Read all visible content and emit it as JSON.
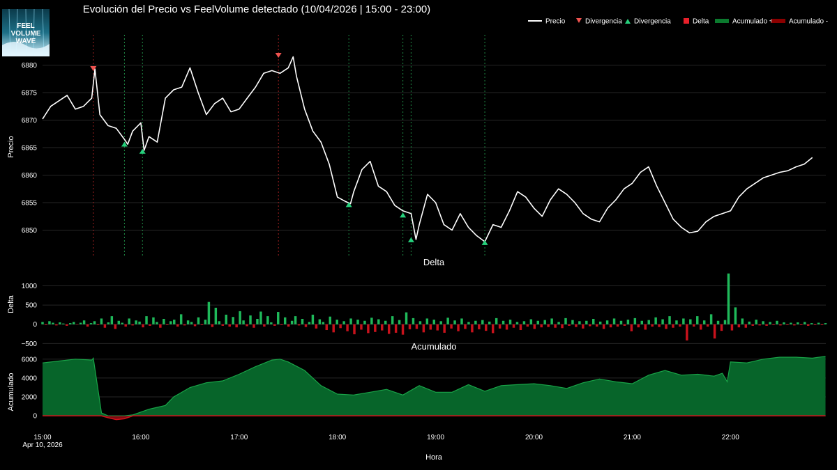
{
  "header": {
    "title": "Evolución del Precio vs FeelVolume detectado (10/04/2026 | 15:00 - 23:00)",
    "logo_text": "FEEL VOLUME WAVE"
  },
  "legend": {
    "placement": "top-right",
    "items": [
      {
        "label": "Precio",
        "kind": "line",
        "color": "#ffffff"
      },
      {
        "label": "Divergencia",
        "kind": "triangle-down",
        "color": "#ef5350"
      },
      {
        "label": "Divergencia",
        "kind": "triangle-up",
        "color": "#26d07c"
      },
      {
        "label": "Delta",
        "kind": "square",
        "color": "#e8202a"
      },
      {
        "label": "Acumulado +",
        "kind": "area",
        "color": "#0b7a2e"
      },
      {
        "label": "Acumulado -",
        "kind": "area",
        "color": "#8b0000"
      }
    ]
  },
  "colors": {
    "background": "#000000",
    "price_line": "#ffffff",
    "div_bear": "#ef5350",
    "div_bull": "#26d07c",
    "delta_pos": "#1fb95a",
    "delta_neg": "#c8121c",
    "acum_pos_fill": "#07652a",
    "acum_pos_line": "#19a448",
    "acum_neg": "#d0101a",
    "grid": "#262626",
    "vline_bear": "#a02020",
    "vline_bull": "#1f8a45"
  },
  "x_axis": {
    "label": "Hora",
    "ticks": [
      {
        "t": 15,
        "label": "15:00",
        "sub": "Apr 10, 2026"
      },
      {
        "t": 16,
        "label": "16:00"
      },
      {
        "t": 17,
        "label": "17:00"
      },
      {
        "t": 18,
        "label": "18:00"
      },
      {
        "t": 19,
        "label": "19:00"
      },
      {
        "t": 20,
        "label": "20:00"
      },
      {
        "t": 21,
        "label": "21:00"
      },
      {
        "t": 22,
        "label": "22:00"
      }
    ],
    "range": [
      15.0,
      22.97
    ]
  },
  "chart_data": [
    {
      "type": "line",
      "name": "precio",
      "ylabel": "Precio",
      "ylim": [
        6845,
        6885.5
      ],
      "yticks": [
        6850,
        6855,
        6860,
        6865,
        6870,
        6875,
        6880
      ],
      "grid": true,
      "x": [
        "15:00",
        "15:05",
        "15:10",
        "15:15",
        "15:20",
        "15:25",
        "15:30",
        "15:32",
        "15:35",
        "15:40",
        "15:45",
        "15:50",
        "15:52",
        "15:55",
        "16:00",
        "16:02",
        "16:05",
        "16:10",
        "16:15",
        "16:20",
        "16:25",
        "16:30",
        "16:35",
        "16:40",
        "16:45",
        "16:50",
        "16:55",
        "17:00",
        "17:05",
        "17:10",
        "17:15",
        "17:20",
        "17:25",
        "17:30",
        "17:33",
        "17:35",
        "17:40",
        "17:45",
        "17:50",
        "17:55",
        "18:00",
        "18:05",
        "18:08",
        "18:10",
        "18:15",
        "18:20",
        "18:25",
        "18:30",
        "18:35",
        "18:40",
        "18:45",
        "18:48",
        "18:50",
        "18:55",
        "19:00",
        "19:05",
        "19:10",
        "19:15",
        "19:20",
        "19:25",
        "19:30",
        "19:35",
        "19:40",
        "19:45",
        "19:50",
        "19:55",
        "20:00",
        "20:05",
        "20:10",
        "20:15",
        "20:20",
        "20:25",
        "20:30",
        "20:35",
        "20:40",
        "20:45",
        "20:50",
        "20:55",
        "21:00",
        "21:05",
        "21:10",
        "21:15",
        "21:20",
        "21:25",
        "21:30",
        "21:35",
        "21:40",
        "21:45",
        "21:50",
        "21:55",
        "22:00",
        "22:05",
        "22:10",
        "22:15",
        "22:20",
        "22:25",
        "22:30",
        "22:35",
        "22:40",
        "22:45",
        "22:50",
        "22:55",
        "22:58"
      ],
      "values": [
        6870.2,
        6872.5,
        6873.5,
        6874.5,
        6872,
        6872.5,
        6874,
        6879.3,
        6871,
        6869,
        6868.5,
        6866.5,
        6865.6,
        6868,
        6869.5,
        6864.5,
        6867,
        6866,
        6874,
        6875.5,
        6876,
        6879.5,
        6875,
        6871,
        6873,
        6874,
        6871.5,
        6872,
        6874,
        6876,
        6878.5,
        6879,
        6878.5,
        6879.5,
        6881.5,
        6878,
        6872,
        6868,
        6866,
        6862,
        6856,
        6855.2,
        6854.8,
        6857,
        6861,
        6862.5,
        6858,
        6857,
        6854.5,
        6853.5,
        6853,
        6848.3,
        6851,
        6856.5,
        6855,
        6851,
        6850,
        6853,
        6850.5,
        6849,
        6847.9,
        6851,
        6850.5,
        6853.5,
        6857,
        6856,
        6854,
        6852.5,
        6855.5,
        6857.5,
        6856.5,
        6855,
        6853,
        6852,
        6851.5,
        6854,
        6855.5,
        6857.5,
        6858.5,
        6860.5,
        6861.5,
        6858,
        6855,
        6852,
        6850.5,
        6849.5,
        6849.8,
        6851.5,
        6852.5,
        6853,
        6853.5,
        6856,
        6857.5,
        6858.5,
        6859.5,
        6860,
        6860.5,
        6860.8,
        6861.5,
        6862,
        6863.2
      ],
      "divergences": [
        {
          "x": "15:31",
          "y": 6879.3,
          "type": "bajista"
        },
        {
          "x": "15:50",
          "y": 6865.7,
          "type": "alcista"
        },
        {
          "x": "16:01",
          "y": 6864.4,
          "type": "alcista"
        },
        {
          "x": "17:24",
          "y": 6881.7,
          "type": "bajista"
        },
        {
          "x": "18:07",
          "y": 6854.7,
          "type": "alcista"
        },
        {
          "x": "18:40",
          "y": 6852.8,
          "type": "alcista"
        },
        {
          "x": "18:45",
          "y": 6848.3,
          "type": "alcista"
        },
        {
          "x": "19:30",
          "y": 6847.8,
          "type": "alcista"
        }
      ]
    },
    {
      "type": "bar",
      "name": "delta",
      "title": "Delta",
      "ylabel": "Delta",
      "ylim": [
        -620,
        1370
      ],
      "yticks": [
        -500,
        0,
        500,
        1000
      ],
      "grid": true,
      "x_start": "15:00",
      "x_end": "22:58",
      "values": [
        60,
        -20,
        80,
        40,
        -30,
        50,
        20,
        -40,
        30,
        60,
        -10,
        40,
        100,
        -60,
        30,
        80,
        -20,
        150,
        -90,
        50,
        210,
        -120,
        90,
        40,
        -60,
        150,
        -30,
        100,
        70,
        -80,
        210,
        -40,
        180,
        60,
        -90,
        140,
        -20,
        80,
        120,
        -60,
        260,
        -30,
        100,
        60,
        -50,
        180,
        -20,
        120,
        580,
        -70,
        430,
        80,
        -40,
        250,
        -60,
        190,
        -80,
        340,
        100,
        -50,
        230,
        -90,
        140,
        330,
        -60,
        210,
        50,
        -40,
        320,
        -20,
        180,
        -60,
        90,
        210,
        -30,
        140,
        -70,
        60,
        250,
        -110,
        130,
        60,
        -150,
        200,
        -210,
        120,
        -100,
        80,
        -180,
        150,
        -260,
        120,
        -140,
        90,
        -230,
        170,
        -200,
        130,
        -160,
        90,
        -250,
        210,
        -220,
        110,
        -270,
        310,
        -130,
        160,
        -120,
        80,
        -210,
        150,
        -140,
        120,
        -160,
        80,
        -220,
        170,
        -110,
        100,
        -180,
        150,
        -120,
        60,
        -210,
        90,
        -130,
        110,
        -170,
        70,
        -230,
        160,
        -110,
        90,
        -140,
        120,
        -90,
        60,
        -150,
        80,
        -60,
        130,
        -120,
        90,
        -80,
        110,
        -70,
        150,
        -90,
        60,
        -100,
        160,
        -40,
        110,
        -70,
        80,
        -110,
        90,
        -50,
        140,
        -60,
        70,
        -120,
        100,
        -80,
        150,
        -60,
        90,
        -40,
        120,
        -180,
        160,
        -80,
        90,
        -140,
        110,
        -60,
        180,
        -70,
        130,
        -120,
        210,
        -90,
        100,
        -60,
        150,
        -420,
        130,
        -60,
        210,
        -140,
        100,
        -60,
        260,
        -370,
        90,
        -170,
        110,
        1320,
        -160,
        440,
        -80,
        150,
        -90,
        70,
        -40,
        120,
        -30,
        80,
        -40,
        60,
        -20,
        90,
        -30,
        50,
        -20,
        40,
        -30,
        50,
        -20,
        60,
        -40,
        30,
        -20,
        40,
        -20,
        30
      ]
    },
    {
      "type": "area",
      "name": "acumulado",
      "title": "Acumulado",
      "ylabel": "Acumulado",
      "ylim": [
        -500,
        6350
      ],
      "yticks": [
        0,
        2000,
        4000,
        6000
      ],
      "grid": true,
      "x": [
        "15:00",
        "15:10",
        "15:20",
        "15:30",
        "15:31",
        "15:36",
        "15:40",
        "15:45",
        "15:50",
        "15:55",
        "16:00",
        "16:05",
        "16:10",
        "16:15",
        "16:20",
        "16:30",
        "16:40",
        "16:50",
        "17:00",
        "17:10",
        "17:20",
        "17:25",
        "17:30",
        "17:40",
        "17:50",
        "18:00",
        "18:10",
        "18:20",
        "18:30",
        "18:40",
        "18:50",
        "19:00",
        "19:10",
        "19:20",
        "19:30",
        "19:40",
        "19:50",
        "20:00",
        "20:10",
        "20:20",
        "20:30",
        "20:40",
        "20:50",
        "21:00",
        "21:10",
        "21:20",
        "21:30",
        "21:40",
        "21:50",
        "21:55",
        "21:58",
        "22:00",
        "22:10",
        "22:20",
        "22:30",
        "22:40",
        "22:50",
        "22:58"
      ],
      "values": [
        5600,
        5800,
        6000,
        5900,
        6100,
        300,
        -200,
        -400,
        -300,
        100,
        400,
        700,
        900,
        1100,
        2000,
        3000,
        3500,
        3700,
        4400,
        5200,
        5900,
        6000,
        5700,
        4800,
        3200,
        2300,
        2200,
        2500,
        2800,
        2200,
        3200,
        2500,
        2500,
        3300,
        2600,
        3200,
        3300,
        3400,
        3200,
        2900,
        3500,
        3900,
        3600,
        3400,
        4300,
        4800,
        4300,
        4400,
        4200,
        4500,
        3600,
        5700,
        5600,
        6000,
        6200,
        6200,
        6100,
        6300
      ]
    }
  ]
}
